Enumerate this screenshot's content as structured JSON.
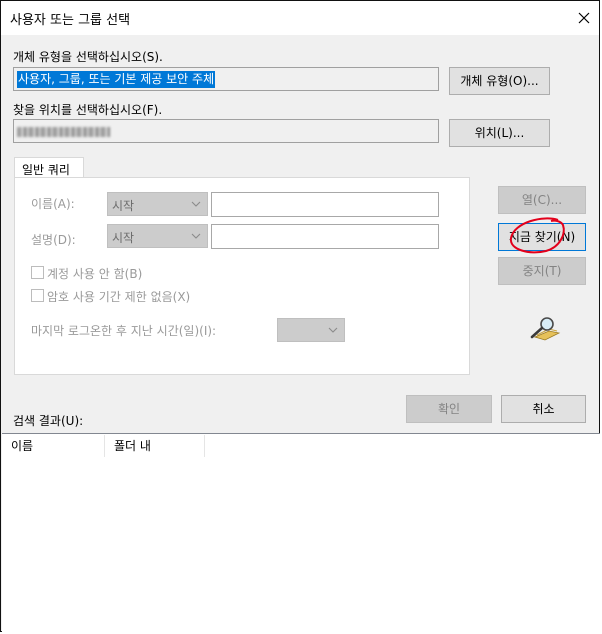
{
  "window": {
    "title": "사용자 또는 그룹 선택"
  },
  "object_type": {
    "label": "개체 유형을 선택하십시오(S).",
    "value": "사용자, 그룹, 또는 기본 제공 보안 주체",
    "button": "개체 유형(O)..."
  },
  "location": {
    "label": "찾을 위치를 선택하십시오(F).",
    "button": "위치(L)..."
  },
  "query": {
    "tab": "일반 쿼리",
    "name_label": "이름(A):",
    "name_mode": "시작",
    "desc_label": "설명(D):",
    "desc_mode": "시작",
    "disabled_accounts": "계정 사용 안 함(B)",
    "non_expiring_pw": "암호 사용 기간 제한 없음(X)",
    "last_logon_label": "마지막 로그온한 후 지난 시간(일)(I):"
  },
  "side_buttons": {
    "columns": "열(C)...",
    "find_now": "지금 찾기(N)",
    "stop": "중지(T)"
  },
  "dialog_buttons": {
    "ok": "확인",
    "cancel": "취소"
  },
  "results": {
    "label": "검색 결과(U):",
    "columns": [
      "이름",
      "폴더 내"
    ]
  },
  "colors": {
    "selection": "#0078d7",
    "annotation": "#e3001b",
    "focus": "#0078d7"
  },
  "icons": {
    "close": "close-icon",
    "search": "search-icon",
    "combo": "chevron-down-icon"
  }
}
